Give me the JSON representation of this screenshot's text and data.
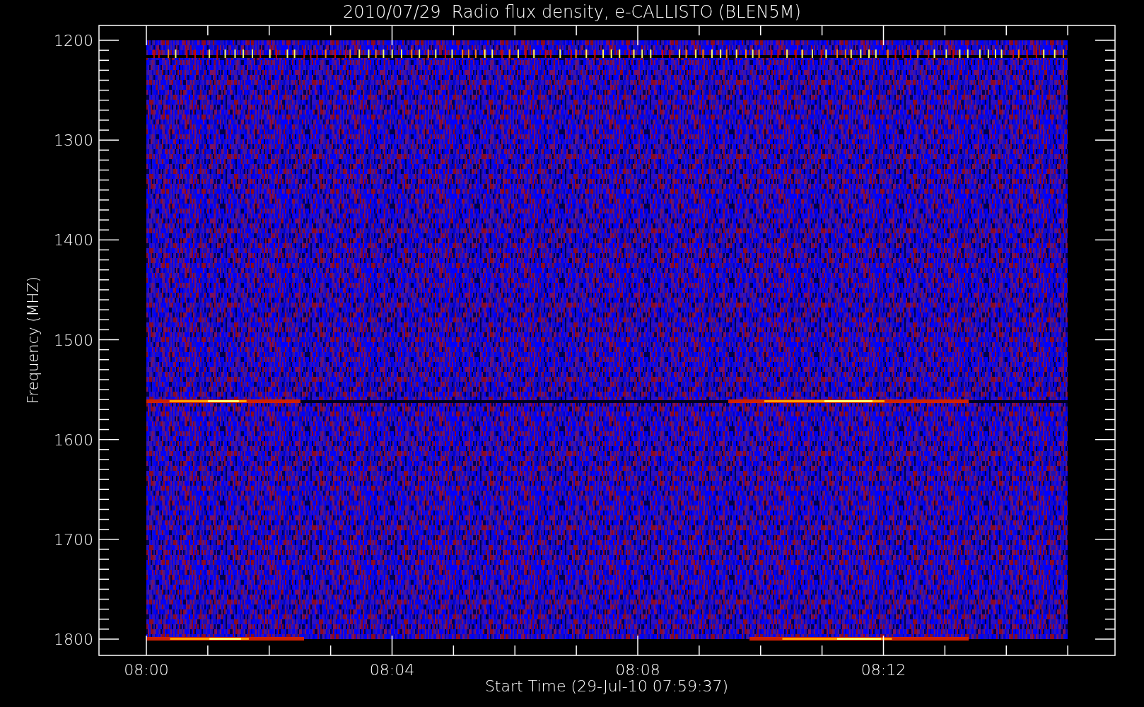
{
  "plot": {
    "title": "2010/07/29  Radio flux density, e-CALLISTO (BLEN5M)",
    "y_axis": {
      "label": "Frequency (MHZ)",
      "ticks": [
        "1200",
        "1300",
        "1400",
        "1500",
        "1600",
        "1700",
        "1800"
      ]
    },
    "x_axis": {
      "label": "Start Time (29-Jul-10 07:59:37)",
      "ticks": [
        "08:00",
        "08:04",
        "08:08",
        "08:12"
      ]
    }
  }
}
